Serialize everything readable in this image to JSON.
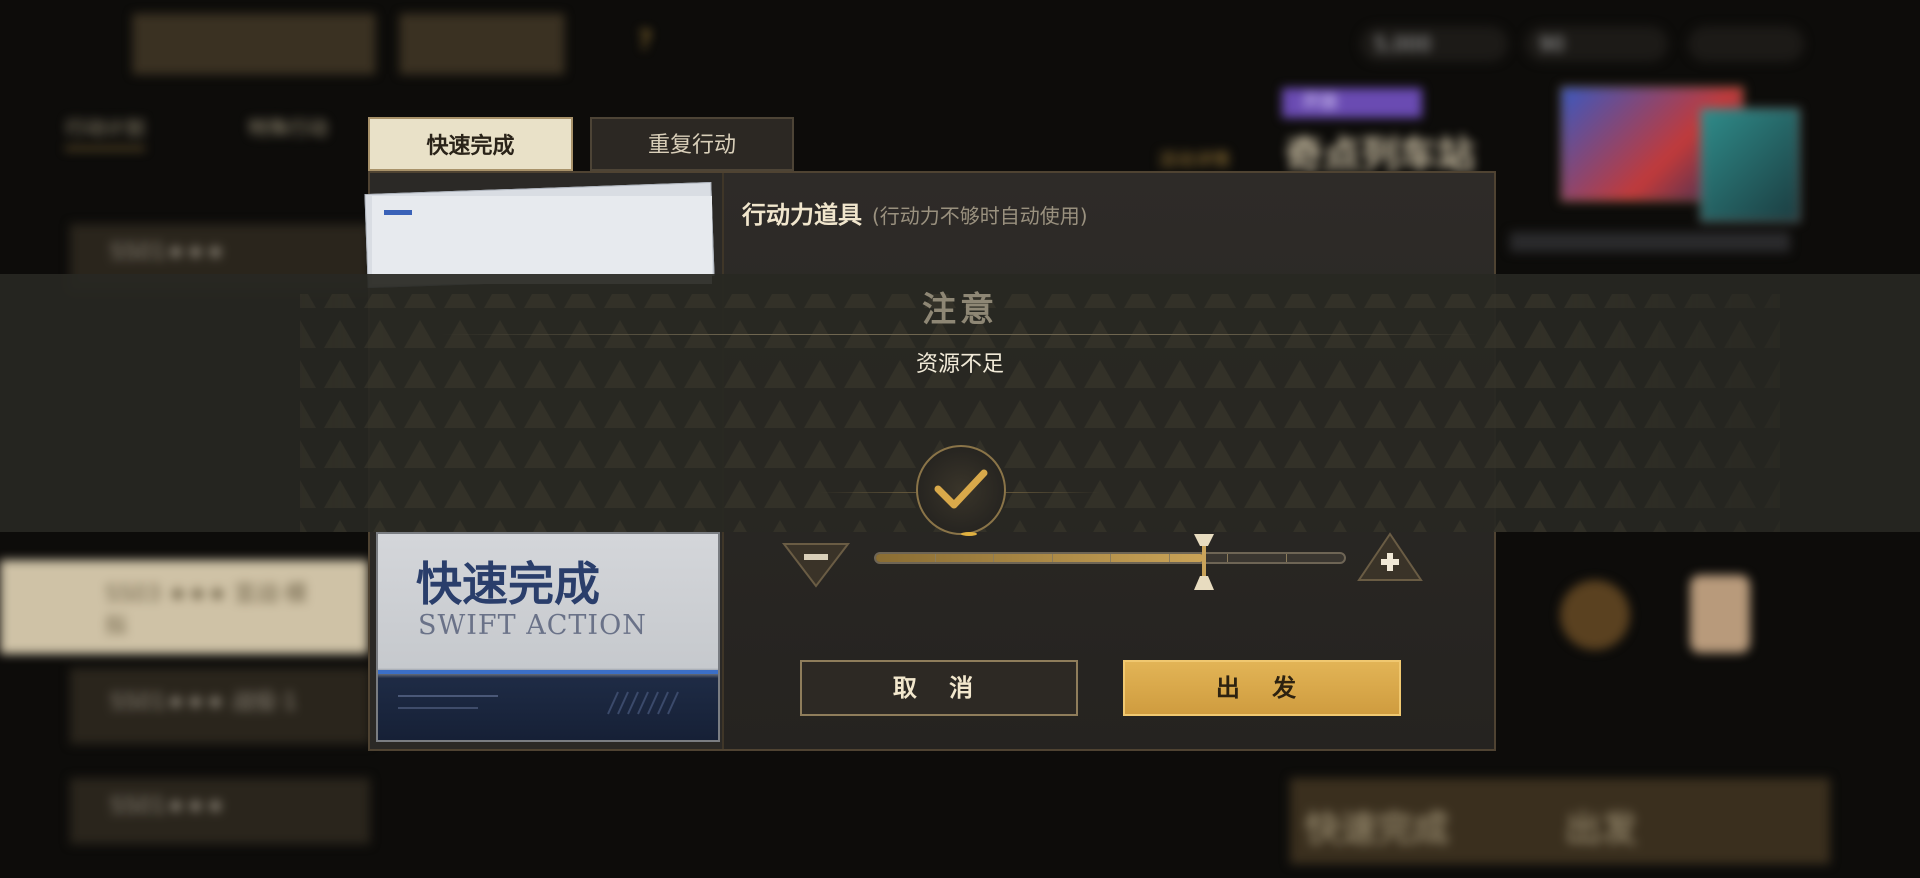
{
  "background": {
    "top_resources": [
      "5,000",
      "90",
      ""
    ],
    "side_tabs": [
      "行动计划",
      "特殊行动"
    ],
    "list_rows": [
      "SS01★★★",
      "SS03 ★★★ 宣战·模拟",
      "SS01★★★ 战役·1",
      "SS01★★★"
    ],
    "event_tag": "开放",
    "event_title": "奇点列车站",
    "event_subtitle": "活动详情",
    "bottom_quick": "快速完成",
    "bottom_go": "出发"
  },
  "tabs": {
    "swift": "快速完成",
    "repeat": "重复行动"
  },
  "panel": {
    "item_title": "行动力道具",
    "item_note": "(行动力不够时自动使用)",
    "ticket_title_cn": "快速完成",
    "ticket_title_en": "SWIFT ACTION"
  },
  "slider": {
    "value_fraction": 0.7,
    "ticks": 8
  },
  "buttons": {
    "cancel": "取 消",
    "go": "出 发"
  },
  "notice": {
    "title": "注意",
    "message": "资源不足"
  },
  "colors": {
    "accent_gold": "#d4a54a",
    "panel_bg": "#2b2926",
    "notice_bg": "#28282a",
    "ticket_blue": "#2a3e6b"
  },
  "icons": {
    "minus": "minus-icon",
    "plus": "plus-icon",
    "confirm": "checkmark-icon"
  }
}
